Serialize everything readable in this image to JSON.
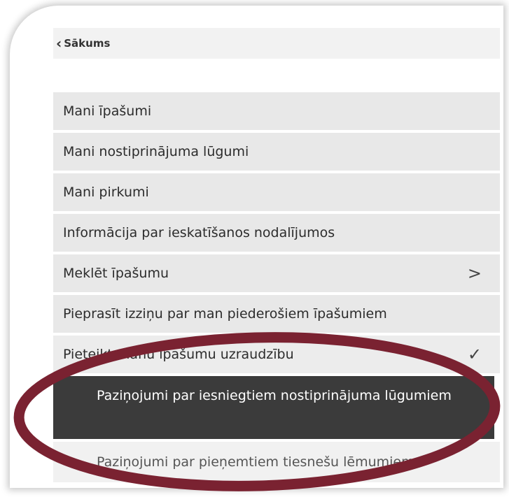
{
  "back": {
    "label": "Sākums"
  },
  "menu": {
    "items": [
      {
        "label": "Mani īpašumi"
      },
      {
        "label": "Mani nostiprinājuma lūgumi"
      },
      {
        "label": "Mani pirkumi"
      },
      {
        "label": "Informācija par ieskatīšanos nodalījumos"
      },
      {
        "label": "Meklēt īpašumu"
      },
      {
        "label": "Pieprasīt izziņu par man piederošiem īpašumiem"
      },
      {
        "label": "Pieteikt manu īpašumu uzraudzību"
      }
    ],
    "sub_items": [
      {
        "label": "Paziņojumi par iesniegtiem nostiprinājuma lūgumiem"
      },
      {
        "label": "Paziņojumi par pieņemtiem tiesnešu lēmumiem"
      }
    ]
  },
  "colors": {
    "highlight_ellipse": "#7a2231",
    "active_background": "#3b3b3b",
    "item_background": "#e8e8e8"
  },
  "icons": {
    "back": "chevron-left-icon",
    "expand": "chevron-right-icon",
    "collapse": "chevron-down-icon"
  }
}
